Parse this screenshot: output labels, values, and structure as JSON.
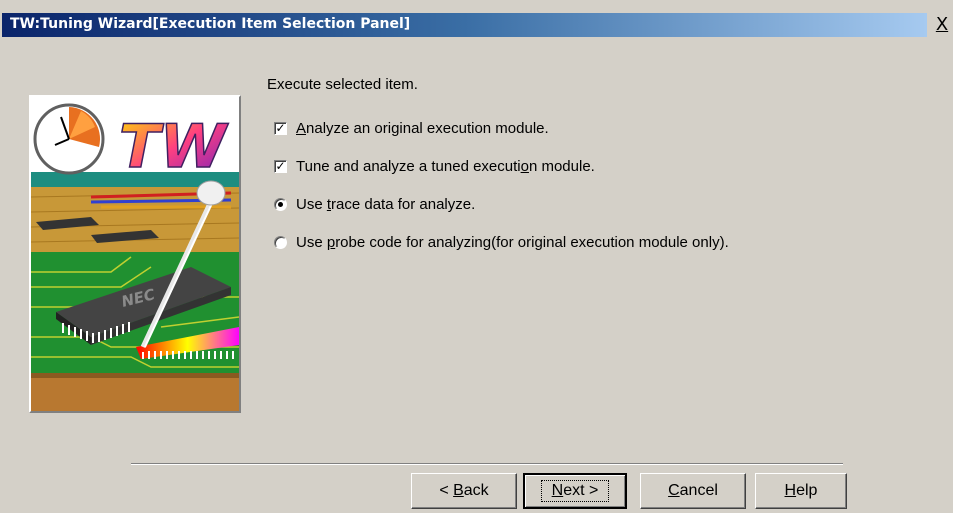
{
  "window": {
    "title": "TW:Tuning Wizard[Execution Item Selection Panel]",
    "close_glyph": "X"
  },
  "artwork": {
    "logo_text": "TW",
    "chip_text": "NEC"
  },
  "main": {
    "prompt": "Execute selected item.",
    "options": [
      {
        "type": "checkbox",
        "checked": true,
        "pre": "",
        "mnemonic": "A",
        "post": "nalyze an original execution module."
      },
      {
        "type": "checkbox",
        "checked": true,
        "pre": "Tune and analyze a tuned executi",
        "mnemonic": "o",
        "post": "n module."
      },
      {
        "type": "radio",
        "checked": true,
        "pre": "Use ",
        "mnemonic": "t",
        "post": "race data for analyze."
      },
      {
        "type": "radio",
        "checked": false,
        "pre": "Use ",
        "mnemonic": "p",
        "post": "robe code for analyzing(for original execution module only)."
      }
    ]
  },
  "buttons": {
    "back": {
      "pre": "< ",
      "mnemonic": "B",
      "post": "ack"
    },
    "next": {
      "pre": "",
      "mnemonic": "N",
      "post": "ext >"
    },
    "cancel": {
      "pre": "",
      "mnemonic": "C",
      "post": "ancel"
    },
    "help": {
      "pre": "",
      "mnemonic": "H",
      "post": "elp"
    }
  },
  "colors": {
    "title_start": "#0a246a",
    "title_end": "#a6caf0",
    "dialog_bg": "#d4d0c8"
  }
}
